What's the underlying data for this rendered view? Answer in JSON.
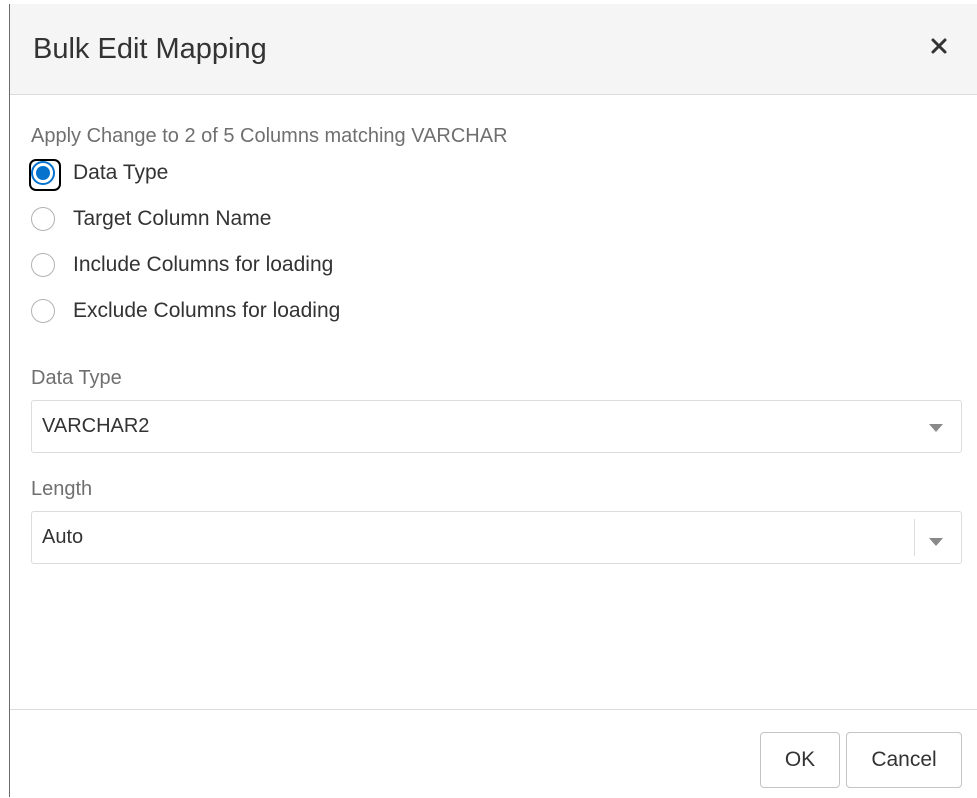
{
  "dialog": {
    "title": "Bulk Edit Mapping",
    "close_icon": "close-icon"
  },
  "body": {
    "subtitle": "Apply Change to 2 of 5 Columns matching VARCHAR",
    "options": [
      {
        "label": "Data Type",
        "checked": true
      },
      {
        "label": "Target Column Name",
        "checked": false
      },
      {
        "label": "Include Columns for loading",
        "checked": false
      },
      {
        "label": "Exclude Columns for loading",
        "checked": false
      }
    ],
    "data_type": {
      "label": "Data Type",
      "value": "VARCHAR2"
    },
    "length": {
      "label": "Length",
      "value": "Auto"
    }
  },
  "footer": {
    "ok_label": "OK",
    "cancel_label": "Cancel"
  },
  "colors": {
    "accent": "#0572ce",
    "header_bg": "#f5f5f5",
    "border": "#dcdcdc"
  }
}
